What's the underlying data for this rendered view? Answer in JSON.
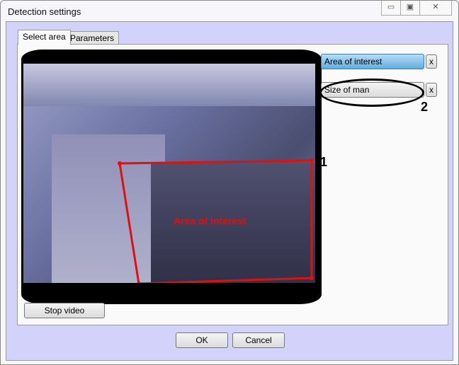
{
  "window": {
    "title": "Detection settings",
    "minimize": "▭",
    "maximize": "▣",
    "close": "✕"
  },
  "tabs": [
    {
      "label": "Select area",
      "active": true
    },
    {
      "label": "Parameters",
      "active": false
    }
  ],
  "video": {
    "overlay_label": "Area of interest",
    "polygon_color": "#e01010"
  },
  "areas": [
    {
      "label": "Area of interest",
      "remove": "x"
    },
    {
      "label": "Size of man",
      "remove": "x"
    }
  ],
  "callouts": [
    "1",
    "2"
  ],
  "buttons": {
    "stop_video": "Stop video",
    "ok": "OK",
    "cancel": "Cancel"
  }
}
